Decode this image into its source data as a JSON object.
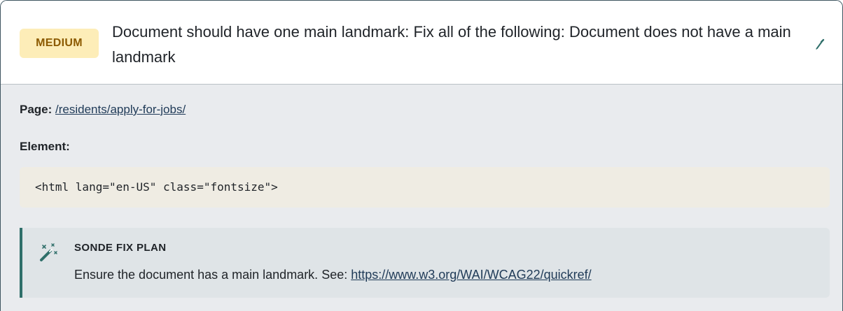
{
  "issue": {
    "severity": "MEDIUM",
    "title": "Document should have one main landmark: Fix all of the following: Document does not have a main landmark",
    "edit_icon": "pencil-icon"
  },
  "details": {
    "page_label": "Page:",
    "page_link": "/residents/apply-for-jobs/",
    "element_label": "Element:",
    "element_code": "<html lang=\"en-US\" class=\"fontsize\">"
  },
  "fix_plan": {
    "icon": "magic-wand-icon",
    "heading": "SONDE FIX PLAN",
    "text": "Ensure the document has a main landmark. See: ",
    "link": "https://www.w3.org/WAI/WCAG22/quickref/"
  },
  "colors": {
    "badge_bg": "#fdedb8",
    "badge_text": "#8c5a00",
    "accent": "#2f6f6a",
    "link": "#1f3a57",
    "code_bg": "#efece3"
  }
}
